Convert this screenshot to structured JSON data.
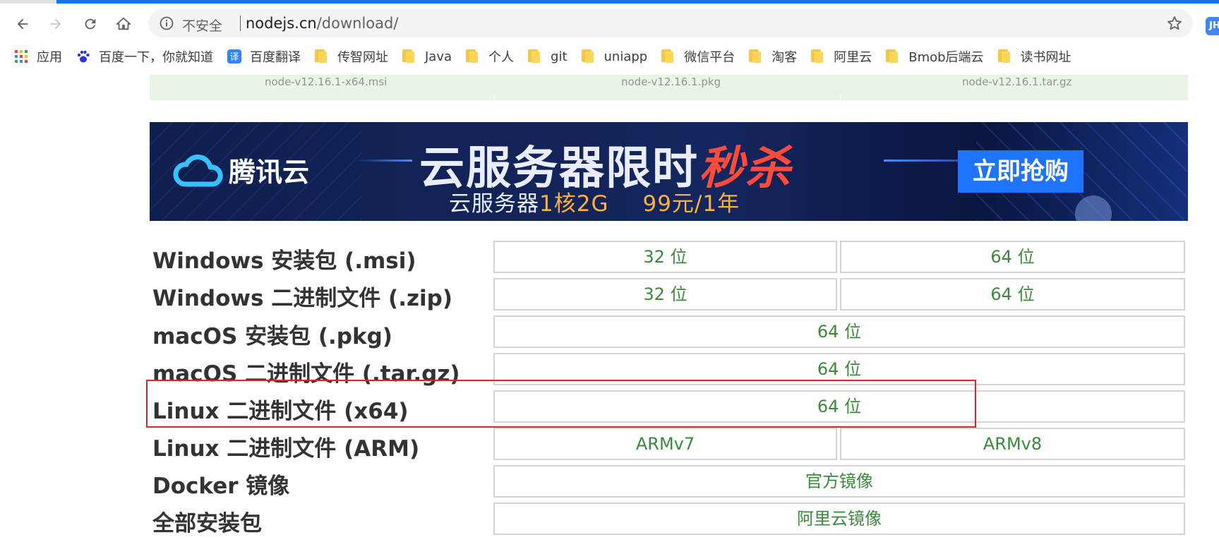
{
  "browser": {
    "url_host": "nodejs.cn",
    "url_path": "/download/",
    "security_label": "不安全",
    "profile_initials": "JH",
    "accent_color": "#1a73e8",
    "icons": [
      "back-icon",
      "forward-icon",
      "reload-icon",
      "home-icon",
      "info-icon",
      "star-icon"
    ]
  },
  "bookmarks": [
    {
      "label": "应用",
      "icon": "apps-grid-icon"
    },
    {
      "label": "百度一下，你就知道",
      "icon": "baidu-paw-icon"
    },
    {
      "label": "百度翻译",
      "icon": "translate-icon"
    },
    {
      "label": "传智网址",
      "icon": "folder-icon"
    },
    {
      "label": "Java",
      "icon": "folder-icon"
    },
    {
      "label": "个人",
      "icon": "folder-icon"
    },
    {
      "label": "git",
      "icon": "folder-icon"
    },
    {
      "label": "uniapp",
      "icon": "folder-icon"
    },
    {
      "label": "微信平台",
      "icon": "folder-icon"
    },
    {
      "label": "淘客",
      "icon": "folder-icon"
    },
    {
      "label": "阿里云",
      "icon": "folder-icon"
    },
    {
      "label": "Bmob后端云",
      "icon": "folder-icon"
    },
    {
      "label": "读书网址",
      "icon": "folder-icon"
    }
  ],
  "installer_files": [
    "node-v12.16.1-x64.msi",
    "node-v12.16.1.pkg",
    "node-v12.16.1.tar.gz"
  ],
  "banner": {
    "brand": "腾讯云",
    "headline_main": "云服务器限时",
    "headline_hot": "秒杀",
    "sub_main": "云服务器",
    "sub_spec": "1核2G",
    "sub_price": "99元/1年",
    "cta": "立即抢购",
    "hot_color": "#ff4b3a",
    "cta_color": "#1e73ff"
  },
  "downloads": [
    {
      "label": "Windows 安装包 (.msi)",
      "links": [
        "32 位",
        "64 位"
      ]
    },
    {
      "label": "Windows 二进制文件 (.zip)",
      "links": [
        "32 位",
        "64 位"
      ]
    },
    {
      "label": "macOS 安装包 (.pkg)",
      "links": [
        "64 位"
      ]
    },
    {
      "label": "macOS 二进制文件 (.tar.gz)",
      "links": [
        "64 位"
      ]
    },
    {
      "label": "Linux 二进制文件 (x64)",
      "links": [
        "64 位"
      ]
    },
    {
      "label": "Linux 二进制文件 (ARM)",
      "links": [
        "ARMv7",
        "ARMv8"
      ]
    },
    {
      "label": "Docker 镜像",
      "links": [
        "官方镜像"
      ]
    },
    {
      "label": "全部安装包",
      "links": [
        "阿里云镜像"
      ]
    }
  ],
  "link_color": "#3b8a3b",
  "highlight_color": "#e0242b"
}
